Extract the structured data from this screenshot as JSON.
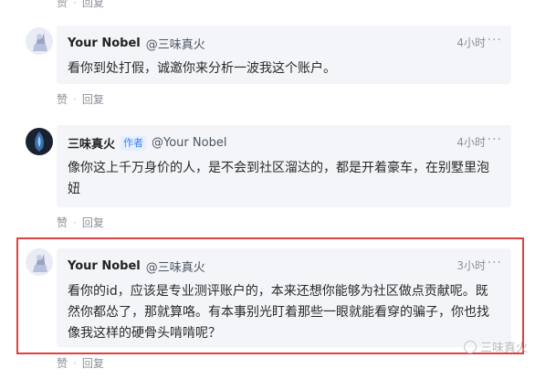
{
  "top_actions": {
    "like": "赞",
    "reply": "回复"
  },
  "comments": [
    {
      "author": "Your Nobel",
      "mention": "@三味真火",
      "badge": "",
      "time": "4小时",
      "more": "···",
      "text": "看你到处打假，诚邀你来分析一波我这个账户。",
      "actions": {
        "like": "赞",
        "reply": "回复"
      }
    },
    {
      "author": "三味真火",
      "mention": "@Your Nobel",
      "badge": "作者",
      "time": "4小时",
      "more": "···",
      "text": "像你这上千万身价的人，是不会到社区溜达的，都是开着豪车，在别墅里泡妞",
      "actions": {
        "like": "赞",
        "reply": "回复"
      }
    },
    {
      "author": "Your Nobel",
      "mention": "@三味真火",
      "badge": "",
      "time": "3小时",
      "more": "···",
      "text": "看你的id，应该是专业测评账户的，本来还想你能够为社区做点贡献呢。既然你都怂了，那就算咯。有本事别光盯着那些一眼就能看穿的骗子，你也找像我这样的硬骨头啃啃呢？",
      "actions": {
        "like": "赞",
        "reply": "回复"
      }
    }
  ],
  "watermark": "三味真火"
}
